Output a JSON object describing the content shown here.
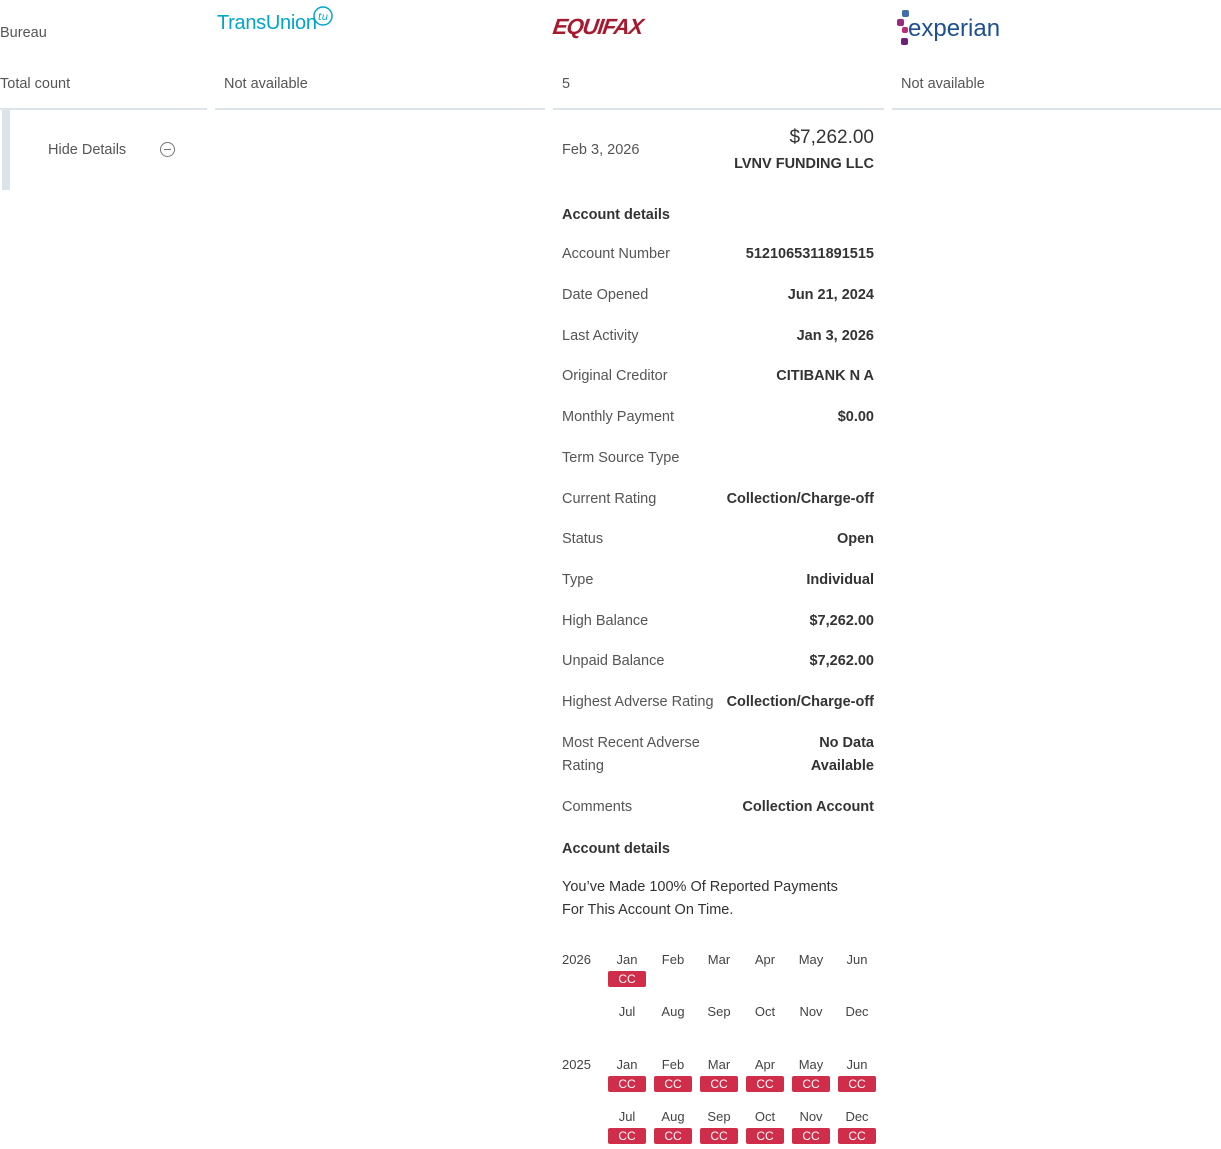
{
  "rows": {
    "bureau": "Bureau",
    "total_count": "Total count"
  },
  "bureaus": {
    "transunion": {
      "logo_text": "TransUnion",
      "badge": "tu",
      "total": "Not available"
    },
    "equifax": {
      "logo_text": "EQUIFAX",
      "total": "5"
    },
    "experian": {
      "logo_text": "experian",
      "total": "Not available"
    }
  },
  "toggle": {
    "label": "Hide Details",
    "icon": "minus-circle-icon"
  },
  "account": {
    "date": "Feb 3, 2026",
    "amount": "$7,262.00",
    "creditor": "LVNV FUNDING LLC",
    "section_title": "Account details",
    "details": [
      {
        "label": "Account Number",
        "value": "5121065311891515"
      },
      {
        "label": "Date Opened",
        "value": "Jun 21, 2024"
      },
      {
        "label": "Last Activity",
        "value": "Jan 3, 2026"
      },
      {
        "label": "Original Creditor",
        "value": "CITIBANK N A"
      },
      {
        "label": "Monthly Payment",
        "value": "$0.00"
      },
      {
        "label": "Term Source Type",
        "value": ""
      },
      {
        "label": "Current Rating",
        "value": "Collection/Charge-off"
      },
      {
        "label": "Status",
        "value": "Open"
      },
      {
        "label": "Type",
        "value": "Individual"
      },
      {
        "label": "High Balance",
        "value": "$7,262.00"
      },
      {
        "label": "Unpaid Balance",
        "value": "$7,262.00"
      },
      {
        "label": "Highest Adverse Rating",
        "value": "Collection/Charge-off"
      },
      {
        "label_line1": "Most Recent Adverse",
        "label_line2": "Rating",
        "value_line1": "No Data",
        "value_line2": "Available"
      },
      {
        "label": "Comments",
        "value": "Collection Account"
      }
    ],
    "history_title": "Account details",
    "history_message_line1": "You’ve Made 100% Of Reported Payments",
    "history_message_line2": "For This Account On Time.",
    "history": [
      {
        "year": "2026",
        "months": [
          "Jan",
          "Feb",
          "Mar",
          "Apr",
          "May",
          "Jun",
          "Jul",
          "Aug",
          "Sep",
          "Oct",
          "Nov",
          "Dec"
        ],
        "codes": [
          "CC",
          "",
          "",
          "",
          "",
          "",
          "",
          "",
          "",
          "",
          "",
          ""
        ]
      },
      {
        "year": "2025",
        "months": [
          "Jan",
          "Feb",
          "Mar",
          "Apr",
          "May",
          "Jun",
          "Jul",
          "Aug",
          "Sep",
          "Oct",
          "Nov",
          "Dec"
        ],
        "codes": [
          "CC",
          "CC",
          "CC",
          "CC",
          "CC",
          "CC",
          "CC",
          "CC",
          "CC",
          "CC",
          "CC",
          "CC"
        ]
      }
    ]
  },
  "colors": {
    "transunion": "#00a6ca",
    "equifax": "#a6192e",
    "experian": "#1d4f91",
    "cc_badge": "#d02d4b",
    "rule": "#dde3ea"
  }
}
